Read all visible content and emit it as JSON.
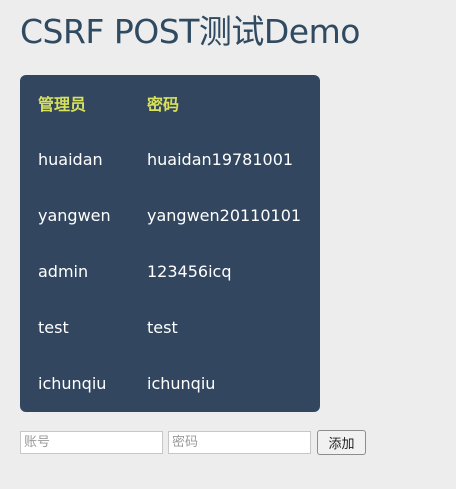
{
  "page": {
    "title": "CSRF POST测试Demo"
  },
  "table": {
    "headers": {
      "user": "管理员",
      "password": "密码"
    },
    "rows": [
      {
        "user": "huaidan",
        "password": "huaidan19781001"
      },
      {
        "user": "yangwen",
        "password": "yangwen20110101"
      },
      {
        "user": "admin",
        "password": "123456icq"
      },
      {
        "user": "test",
        "password": "test"
      },
      {
        "user": "ichunqiu",
        "password": "ichunqiu"
      }
    ]
  },
  "form": {
    "account_placeholder": "账号",
    "password_placeholder": "密码",
    "add_button_label": "添加"
  }
}
